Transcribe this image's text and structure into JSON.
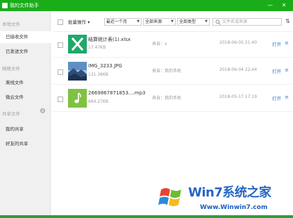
{
  "window": {
    "title": "我的文件助手",
    "minimize_glyph": "—",
    "close_glyph": "✕"
  },
  "sidebar": {
    "local_header": "本地文件",
    "local_items": [
      {
        "label": "已接收文件",
        "active": true
      },
      {
        "label": "已发送文件",
        "active": false
      }
    ],
    "cloud_header": "网络文件",
    "cloud_items": [
      {
        "label": "离线文件"
      },
      {
        "label": "微云文件"
      }
    ],
    "share_header": "共享文件",
    "share_items": [
      {
        "label": "我的共享"
      },
      {
        "label": "好友的共享"
      }
    ]
  },
  "toolbar": {
    "batch_label": "批量操作",
    "time_filter": "最近一个月",
    "source_filter": "全部来源",
    "type_filter": "全部类型",
    "search_placeholder": "文件名或来源",
    "sort_glyph": "⇅"
  },
  "files": [
    {
      "name": "结算统计表(1).xlsx",
      "size": "17.47KB",
      "source": "来自：x",
      "date": "2018-06-05 21:40",
      "open_label": "打开",
      "type": "excel"
    },
    {
      "name": "IMG_3233.JPG",
      "size": "131.36KB",
      "source": "来自：我的手机",
      "date": "2018-06-04 22:44",
      "open_label": "打开",
      "type": "image"
    },
    {
      "name": "2669867871853....mp3",
      "size": "664.27KB",
      "source": "来自：我的手机",
      "date": "2018-05-17 17:19",
      "open_label": "打开",
      "type": "audio"
    }
  ],
  "watermark": {
    "title": "Win7系统之家",
    "url": "Www.Winwin7.com"
  },
  "colors": {
    "brand_green": "#1aad19",
    "link_blue": "#2f7fd7",
    "excel_green": "#1fa96a",
    "audio_green": "#7fc241"
  }
}
